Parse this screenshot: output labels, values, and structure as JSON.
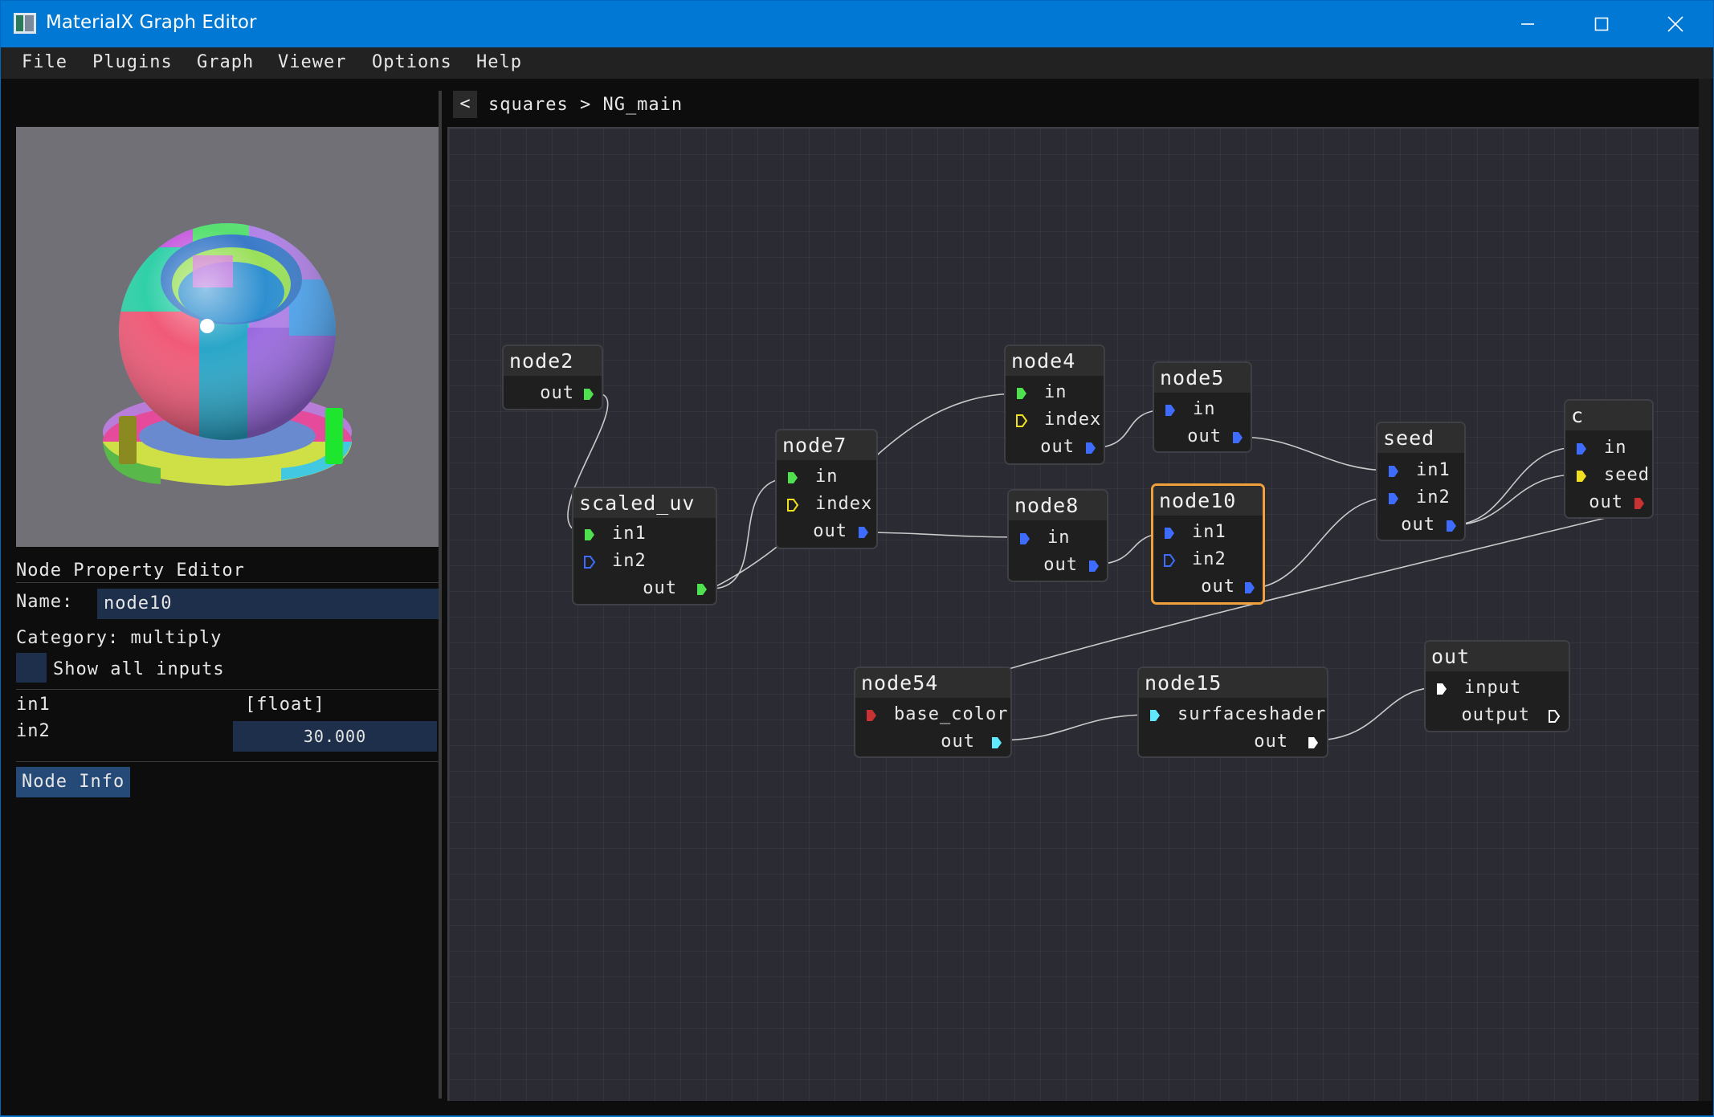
{
  "window": {
    "title": "MaterialX Graph Editor"
  },
  "menu": [
    "File",
    "Plugins",
    "Graph",
    "Viewer",
    "Options",
    "Help"
  ],
  "property_editor": {
    "heading": "Node Property Editor",
    "name_label": "Name:",
    "name_value": "node10",
    "category": "Category: multiply",
    "show_all_inputs": "Show all inputs",
    "inputs": [
      {
        "name": "in1",
        "value": "[float]"
      },
      {
        "name": "in2",
        "value": "30.000"
      }
    ],
    "node_info_button": "Node Info"
  },
  "graph": {
    "back": "<",
    "breadcrumb": "squares > NG_main",
    "nodes": {
      "node2": {
        "title": "node2",
        "out": "out"
      },
      "scaled_uv": {
        "title": "scaled_uv",
        "in1": "in1",
        "in2": "in2",
        "out": "out"
      },
      "node7": {
        "title": "node7",
        "in": "in",
        "index": "index",
        "out": "out"
      },
      "node4": {
        "title": "node4",
        "in": "in",
        "index": "index",
        "out": "out"
      },
      "node5": {
        "title": "node5",
        "in": "in",
        "out": "out"
      },
      "node8": {
        "title": "node8",
        "in": "in",
        "out": "out"
      },
      "node10": {
        "title": "node10",
        "in1": "in1",
        "in2": "in2",
        "out": "out"
      },
      "seed": {
        "title": "seed",
        "in1": "in1",
        "in2": "in2",
        "out": "out"
      },
      "c": {
        "title": "c",
        "in": "in",
        "seed": "seed",
        "out": "out"
      },
      "node54": {
        "title": "node54",
        "base_color": "base_color",
        "out": "out"
      },
      "node15": {
        "title": "node15",
        "surfaceshader": "surfaceshader",
        "out": "out"
      },
      "out": {
        "title": "out",
        "input": "input",
        "output": "output"
      }
    }
  },
  "colors": {
    "vector2_pin": "#4ee04e",
    "float_pin": "#3d6cff",
    "integer_pin": "#f0e020",
    "color3_pin": "#c83232",
    "surfaceshader_pin": "#60e8ff",
    "material_pin": "#ffffff",
    "selection": "#f0a03c",
    "title_bar": "#0078d4"
  }
}
